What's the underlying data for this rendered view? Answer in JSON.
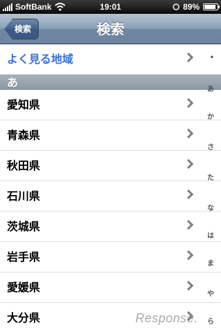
{
  "status": {
    "carrier": "SoftBank",
    "time": "19:01",
    "battery": "89%",
    "battery_level": 0.89
  },
  "nav": {
    "back_label": "検索",
    "title": "検索"
  },
  "frequent": {
    "label": "よく見る地域"
  },
  "section": {
    "header": "あ"
  },
  "prefectures": [
    "愛知県",
    "青森県",
    "秋田県",
    "石川県",
    "茨城県",
    "岩手県",
    "愛媛県",
    "大分県"
  ],
  "index": [
    "•",
    "あ",
    "か",
    "さ",
    "た",
    "な",
    "は",
    "ま",
    "や",
    "ら"
  ],
  "watermark": "Response."
}
